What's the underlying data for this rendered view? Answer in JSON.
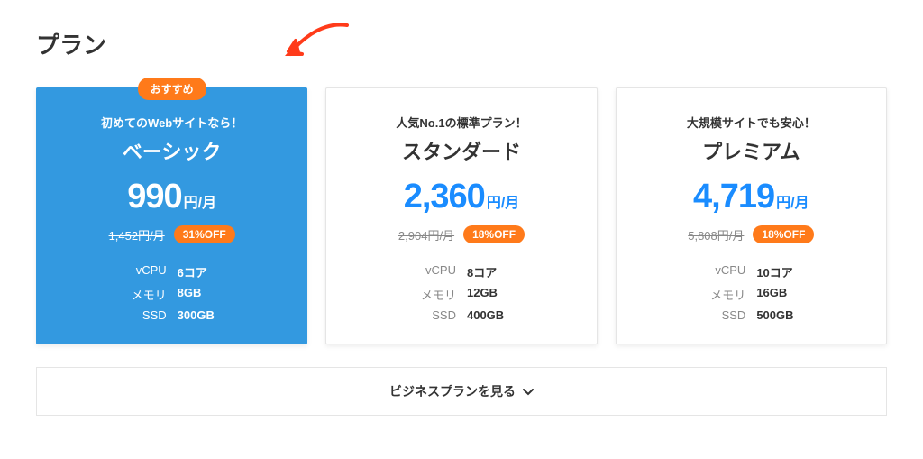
{
  "section_title": "プラン",
  "recommended_badge": "おすすめ",
  "price_unit": "円/月",
  "spec_labels": {
    "vcpu": "vCPU",
    "memory": "メモリ",
    "ssd": "SSD"
  },
  "plans": [
    {
      "tagline": "初めてのWebサイトなら！",
      "name": "ベーシック",
      "price": "990",
      "original": "1,452円/月",
      "discount": "31%OFF",
      "vcpu": "6コア",
      "memory": "8GB",
      "ssd": "300GB",
      "selected": true,
      "recommended": true
    },
    {
      "tagline": "人気No.1の標準プラン！",
      "name": "スタンダード",
      "price": "2,360",
      "original": "2,904円/月",
      "discount": "18%OFF",
      "vcpu": "8コア",
      "memory": "12GB",
      "ssd": "400GB",
      "selected": false,
      "recommended": false
    },
    {
      "tagline": "大規模サイトでも安心！",
      "name": "プレミアム",
      "price": "4,719",
      "original": "5,808円/月",
      "discount": "18%OFF",
      "vcpu": "10コア",
      "memory": "16GB",
      "ssd": "500GB",
      "selected": false,
      "recommended": false
    }
  ],
  "business_link": "ビジネスプランを見る",
  "colors": {
    "accent_blue": "#3399e0",
    "price_blue": "#1a8cff",
    "orange": "#ff7a1a"
  }
}
